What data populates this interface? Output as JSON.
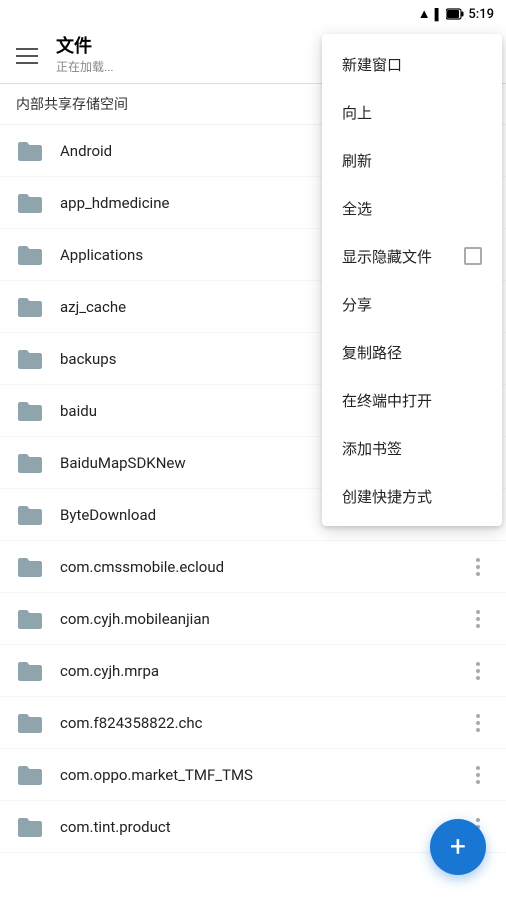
{
  "statusBar": {
    "time": "5:19"
  },
  "header": {
    "menuIcon": "menu",
    "title": "文件",
    "subtitle": "正在加载..."
  },
  "storage": {
    "label": "内部共享存储空间"
  },
  "menu": {
    "items": [
      {
        "id": "new-window",
        "label": "新建窗口",
        "hasCheckbox": false
      },
      {
        "id": "up",
        "label": "向上",
        "hasCheckbox": false
      },
      {
        "id": "refresh",
        "label": "刷新",
        "hasCheckbox": false
      },
      {
        "id": "select-all",
        "label": "全选",
        "hasCheckbox": false
      },
      {
        "id": "show-hidden",
        "label": "显示隐藏文件",
        "hasCheckbox": true
      },
      {
        "id": "share",
        "label": "分享",
        "hasCheckbox": false
      },
      {
        "id": "copy-path",
        "label": "复制路径",
        "hasCheckbox": false
      },
      {
        "id": "open-terminal",
        "label": "在终端中打开",
        "hasCheckbox": false
      },
      {
        "id": "add-bookmark",
        "label": "添加书签",
        "hasCheckbox": false
      },
      {
        "id": "create-shortcut",
        "label": "创建快捷方式",
        "hasCheckbox": false
      }
    ]
  },
  "files": [
    {
      "id": "android",
      "name": "Android",
      "hasMore": false
    },
    {
      "id": "app-hdmedicine",
      "name": "app_hdmedicine",
      "hasMore": false
    },
    {
      "id": "applications",
      "name": "Applications",
      "hasMore": false
    },
    {
      "id": "azj-cache",
      "name": "azj_cache",
      "hasMore": false
    },
    {
      "id": "backups",
      "name": "backups",
      "hasMore": false
    },
    {
      "id": "baidu",
      "name": "baidu",
      "hasMore": false
    },
    {
      "id": "baidu-map-sdk",
      "name": "BaiduMapSDKNew",
      "hasMore": true
    },
    {
      "id": "byte-download",
      "name": "ByteDownload",
      "hasMore": true
    },
    {
      "id": "cms-ecloud",
      "name": "com.cmssmobile.ecloud",
      "hasMore": true
    },
    {
      "id": "cyjh-anjian",
      "name": "com.cyjh.mobileanjian",
      "hasMore": true
    },
    {
      "id": "cyjh-mrpa",
      "name": "com.cyjh.mrpa",
      "hasMore": true
    },
    {
      "id": "f824-chc",
      "name": "com.f824358822.chc",
      "hasMore": true
    },
    {
      "id": "oppo-market",
      "name": "com.oppo.market_TMF_TMS",
      "hasMore": true
    },
    {
      "id": "tint-product",
      "name": "com.tint.product",
      "hasMore": true
    }
  ],
  "fab": {
    "label": "+"
  }
}
